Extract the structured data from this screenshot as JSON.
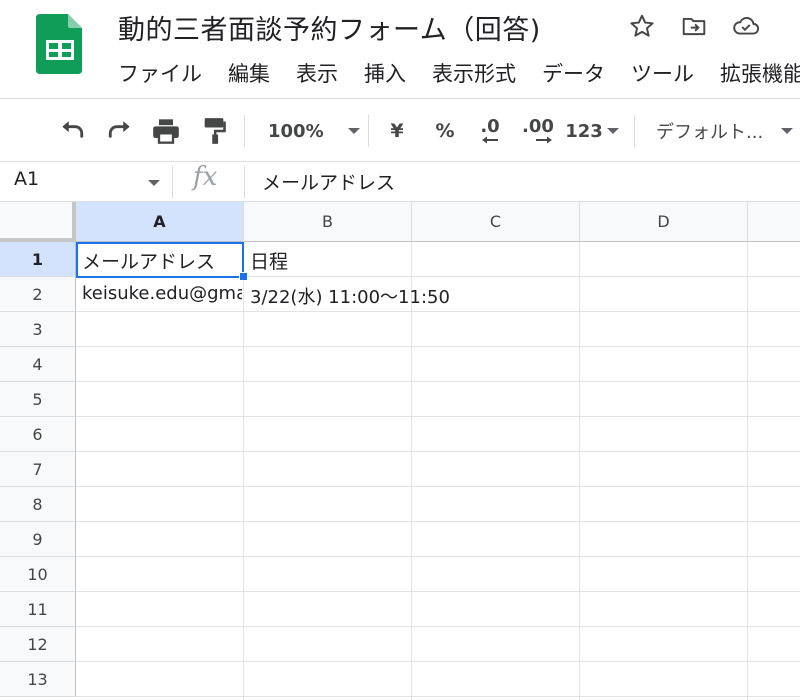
{
  "header": {
    "title": "動的三者面談予約フォーム（回答)",
    "icons": [
      "star-icon",
      "move-to-folder-icon",
      "cloud-saved-icon"
    ],
    "menu": [
      "ファイル",
      "編集",
      "表示",
      "挿入",
      "表示形式",
      "データ",
      "ツール",
      "拡張機能"
    ]
  },
  "toolbar": {
    "zoom": "100%",
    "currency": "¥",
    "percent": "%",
    "decrease_decimal": ".0",
    "increase_decimal": ".00",
    "number_format": "123",
    "font": "デフォルト..."
  },
  "formula_bar": {
    "name_box": "A1",
    "fx_label": "fx",
    "content": "メールアドレス"
  },
  "sheet": {
    "columns": [
      "A",
      "B",
      "C",
      "D"
    ],
    "rows": [
      "1",
      "2",
      "3",
      "4",
      "5",
      "6",
      "7",
      "8",
      "9",
      "10",
      "11",
      "12",
      "13"
    ],
    "cells": {
      "A1": "メールアドレス",
      "B1": "日程",
      "A2": "keisuke.edu@gmail.com",
      "B2": "3/22(水) 11:00〜11:50"
    },
    "selected_cell": "A1"
  },
  "colors": {
    "logo_green": "#0f9d58",
    "selection_blue": "#1a73e8",
    "header_selected": "#d3e3fd"
  }
}
